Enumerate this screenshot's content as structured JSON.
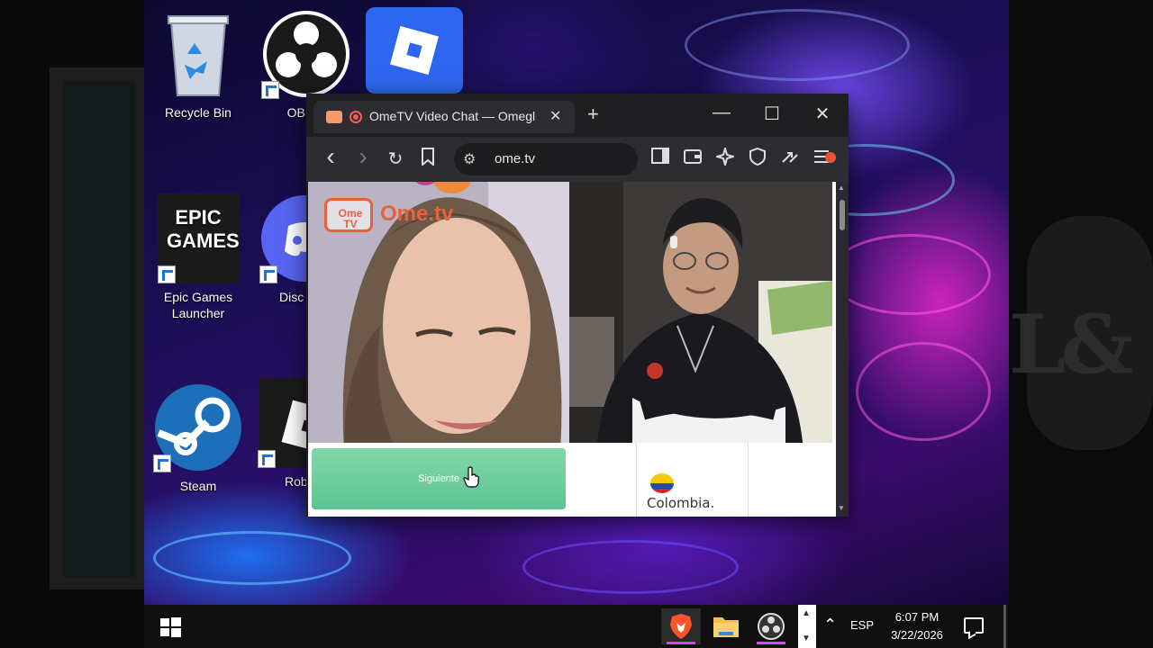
{
  "desktop": {
    "icons": [
      {
        "label": "Recycle Bin",
        "icon": "recycle-bin-icon"
      },
      {
        "label": "OBS S",
        "icon": "obs-studio-icon"
      },
      {
        "label": "",
        "icon": "roblox-studio-icon"
      },
      {
        "label": "Epic Games Launcher",
        "icon": "epic-games-icon",
        "logo_text": "EPIC GAMES"
      },
      {
        "label": "Disc",
        "icon": "discord-icon"
      },
      {
        "label": "Steam",
        "icon": "steam-icon"
      },
      {
        "label": "Roblox",
        "icon": "roblox-icon"
      }
    ]
  },
  "browser": {
    "tab": {
      "title": "OmeTV Video Chat — Omegl",
      "close": "✕"
    },
    "new_tab": "+",
    "window_buttons": {
      "minimize": "—",
      "maximize": "☐",
      "close": "✕"
    },
    "toolbar": {
      "back": "‹",
      "forward": "›",
      "reload": "↻",
      "url": "ome.tv"
    }
  },
  "page": {
    "logo": {
      "tv_text": "Ome TV",
      "name": "Ome.tv"
    },
    "next_button": "Siguiente",
    "country": "Colombia.",
    "accent": "#5ec48f"
  },
  "taskbar": {
    "language": "ESP",
    "time": "6:07 PM",
    "date": "3/22/2026"
  }
}
